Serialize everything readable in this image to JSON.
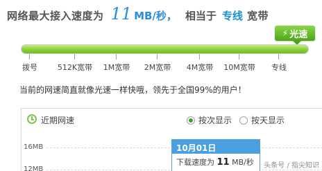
{
  "headline": {
    "prefix": "网络最大接入速度为",
    "speed_value": "11",
    "speed_unit": "MB/秒，",
    "equivalent_label": "相当于",
    "line_type": "专线",
    "line_suffix": "宽带"
  },
  "badge": {
    "icon": "lightning-icon",
    "text": "光速"
  },
  "speed_meter": {
    "fill_fraction": 1.0,
    "scale_labels": [
      "拨号",
      "512K宽带",
      "1M宽带",
      "2M宽带",
      "4M宽带",
      "10M宽带",
      "专线"
    ]
  },
  "description": "当前的网速简直就像光速一样快哦，领先于全国99%的用户！",
  "chart_panel": {
    "title": "近期网速",
    "title_icon": "clock-icon",
    "options": [
      {
        "label": "按次显示",
        "selected": true
      },
      {
        "label": "按天显示",
        "selected": false
      }
    ],
    "y_labels": [
      "16MB",
      "12MB"
    ],
    "tooltip": {
      "date": "10月01日",
      "label": "下载速度为",
      "value": "11",
      "unit": "MB/秒"
    }
  },
  "watermark": "头条号 / 指尖知识",
  "colors": {
    "accent": "#2a8ce0",
    "green": "#6dbb26",
    "tooltip_blue": "#4a9fe0"
  }
}
